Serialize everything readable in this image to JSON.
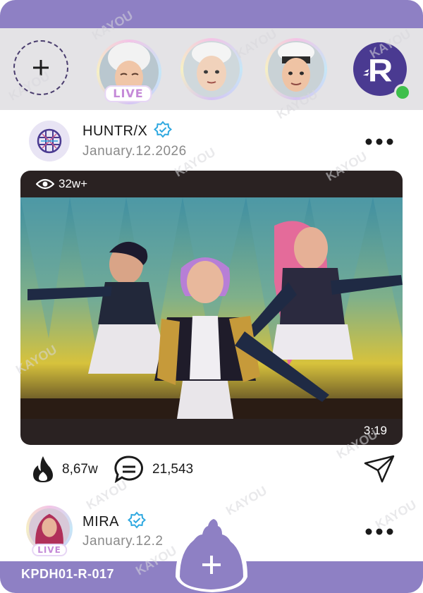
{
  "stories": {
    "live_label": "LIVE"
  },
  "post": {
    "username": "HUNTR/X",
    "date": "January.12.2026",
    "views": "32w+",
    "duration": "3:19",
    "likes": "8,67w",
    "comments": "21,543"
  },
  "next_post": {
    "username": "MIRA",
    "date": "January.12.2",
    "live_label": "LIVE"
  },
  "footer": {
    "card_code": "KPDH01-R-017"
  },
  "watermark": "KAYOU",
  "colors": {
    "band": "#8e80c4",
    "brand": "#4a3a91",
    "online": "#3fbf4c",
    "verified": "#2ea8e0",
    "media_bg": "#2a2222"
  },
  "icons": [
    "plus-icon",
    "brand-r-icon",
    "verified-icon",
    "more-icon",
    "eye-icon",
    "flame-icon",
    "comment-icon",
    "send-icon"
  ]
}
